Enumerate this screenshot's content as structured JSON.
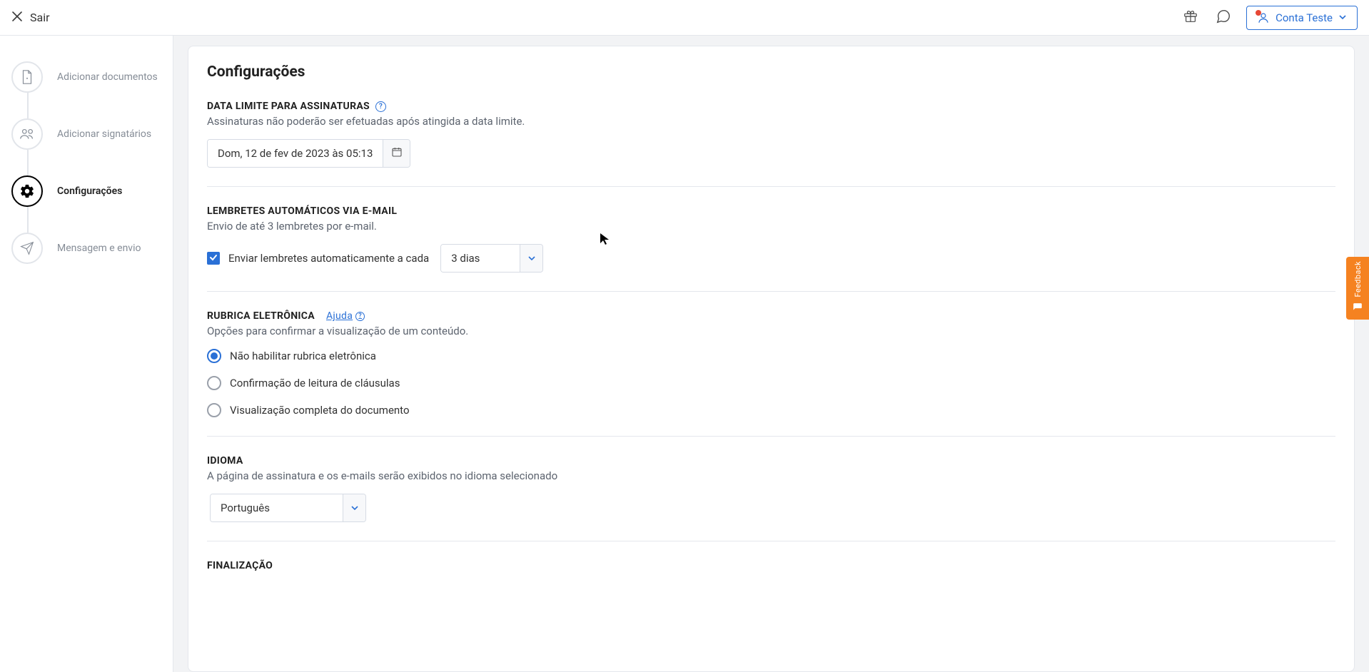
{
  "header": {
    "exit_label": "Sair",
    "account_label": "Conta Teste"
  },
  "sidebar": {
    "items": [
      {
        "label": "Adicionar documentos"
      },
      {
        "label": "Adicionar signatários"
      },
      {
        "label": "Configurações"
      },
      {
        "label": "Mensagem e envio"
      }
    ],
    "active_index": 2
  },
  "page": {
    "title": "Configurações"
  },
  "deadline": {
    "title": "DATA LIMITE PARA ASSINATURAS",
    "desc": "Assinaturas não poderão ser efetuadas após atingida a data limite.",
    "value": "Dom, 12 de fev de 2023 às 05:13"
  },
  "reminders": {
    "title": "LEMBRETES AUTOMÁTICOS VIA E-MAIL",
    "desc": "Envio de até 3 lembretes por e-mail.",
    "checkbox_label": "Enviar lembretes automaticamente a cada",
    "checkbox_checked": true,
    "interval_selected": "3 dias"
  },
  "rubrica": {
    "title": "RUBRICA ELETRÔNICA",
    "help_label": "Ajuda",
    "desc": "Opções para confirmar a visualização de um conteúdo.",
    "options": [
      "Não habilitar rubrica eletrônica",
      "Confirmação de leitura de cláusulas",
      "Visualização completa do documento"
    ],
    "selected_index": 0
  },
  "language": {
    "title": "IDIOMA",
    "desc": "A página de assinatura e os e-mails serão exibidos no idioma selecionado",
    "selected": "Português"
  },
  "finalization": {
    "title": "FINALIZAÇÃO"
  },
  "feedback": {
    "label": "Feedback"
  }
}
